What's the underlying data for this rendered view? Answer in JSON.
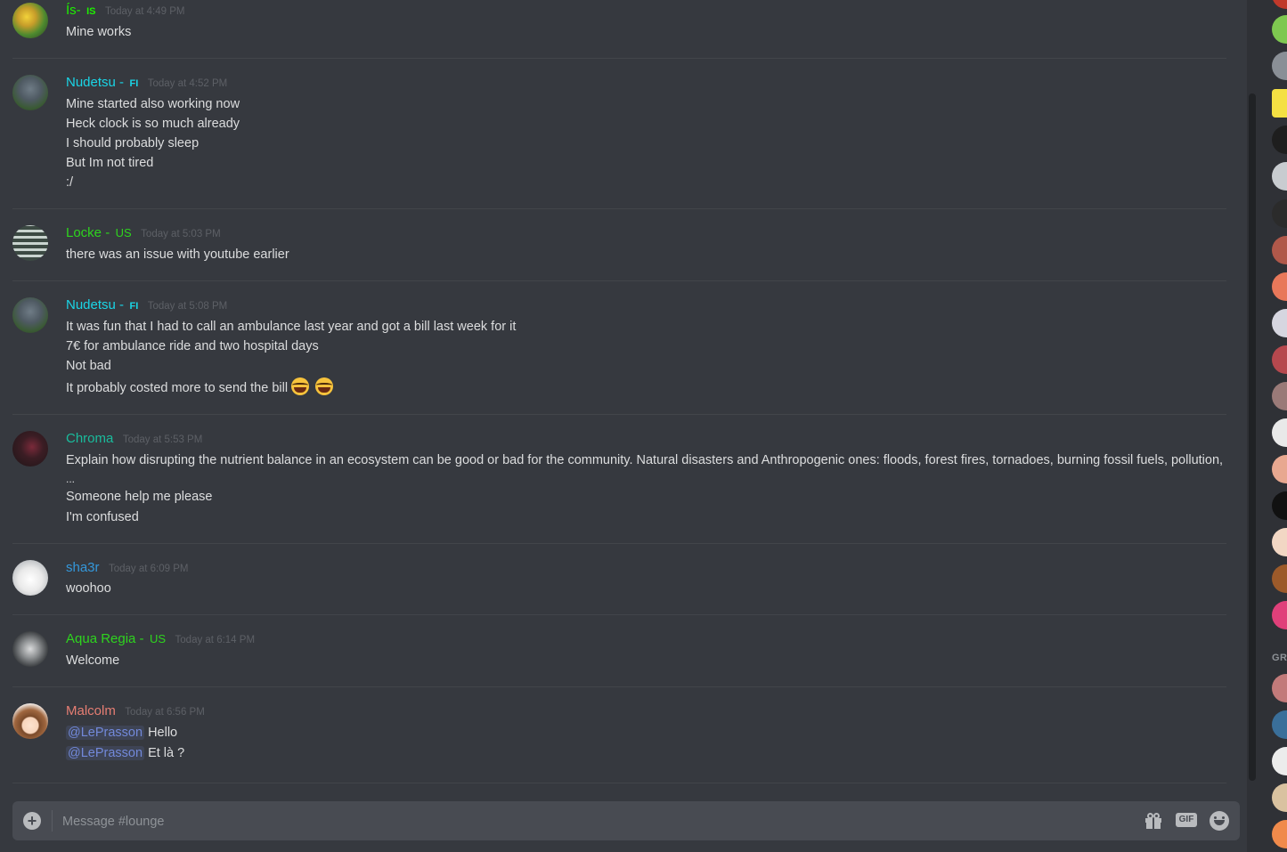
{
  "channel": "lounge",
  "composer": {
    "placeholder": "Message #lounge",
    "gif_label": "GIF"
  },
  "messages": [
    {
      "username": "Ís-",
      "tag": "IS",
      "timestamp": "Today at 4:49 PM",
      "name_color": "#1ef000",
      "lines": [
        "Mine works"
      ]
    },
    {
      "username": "Nudetsu -",
      "tag": "FI",
      "timestamp": "Today at 4:52 PM",
      "name_color": "#1ad5e6",
      "lines": [
        "Mine started also working now",
        "Heck clock is so much already",
        "I should probably sleep",
        "But Im not tired",
        ":/"
      ]
    },
    {
      "username": "Locke -",
      "tag": "US",
      "timestamp": "Today at 5:03 PM",
      "name_color": "#2ed41e",
      "lines": [
        "there was an issue with youtube earlier"
      ]
    },
    {
      "username": "Nudetsu -",
      "tag": "FI",
      "timestamp": "Today at 5:08 PM",
      "name_color": "#1ad5e6",
      "lines": [
        "It was fun that I had to call an ambulance last year and got a bill last week for it",
        "7€ for ambulance ride and two hospital days",
        "Not bad",
        "It probably costed more to send the bill"
      ],
      "emojis": [
        "joy-emoji",
        "joy-emoji"
      ]
    },
    {
      "username": "Chroma",
      "tag": "",
      "timestamp": "Today at 5:53 PM",
      "name_color": "#1abc9c",
      "lines": [
        "Explain how disrupting the nutrient balance in an ecosystem can be good or bad for the community.  Natural disasters and Anthropogenic ones: floods, forest fires, tornadoes, burning fossil fuels, pollution,",
        "...",
        "Someone help me please",
        "I'm confused"
      ]
    },
    {
      "username": "sha3r",
      "tag": "",
      "timestamp": "Today at 6:09 PM",
      "name_color": "#3498db",
      "lines": [
        "woohoo"
      ]
    },
    {
      "username": "Aqua Regia -",
      "tag": "US",
      "timestamp": "Today at 6:14 PM",
      "name_color": "#2ed41e",
      "lines": [
        "Welcome"
      ]
    },
    {
      "username": "Malcolm",
      "tag": "",
      "timestamp": "Today at 6:56 PM",
      "name_color": "#e67e73",
      "mention": "@LePrasson",
      "lines": [
        "Hello",
        "Et là ?"
      ]
    }
  ],
  "member_list": {
    "section_label": "GR"
  }
}
